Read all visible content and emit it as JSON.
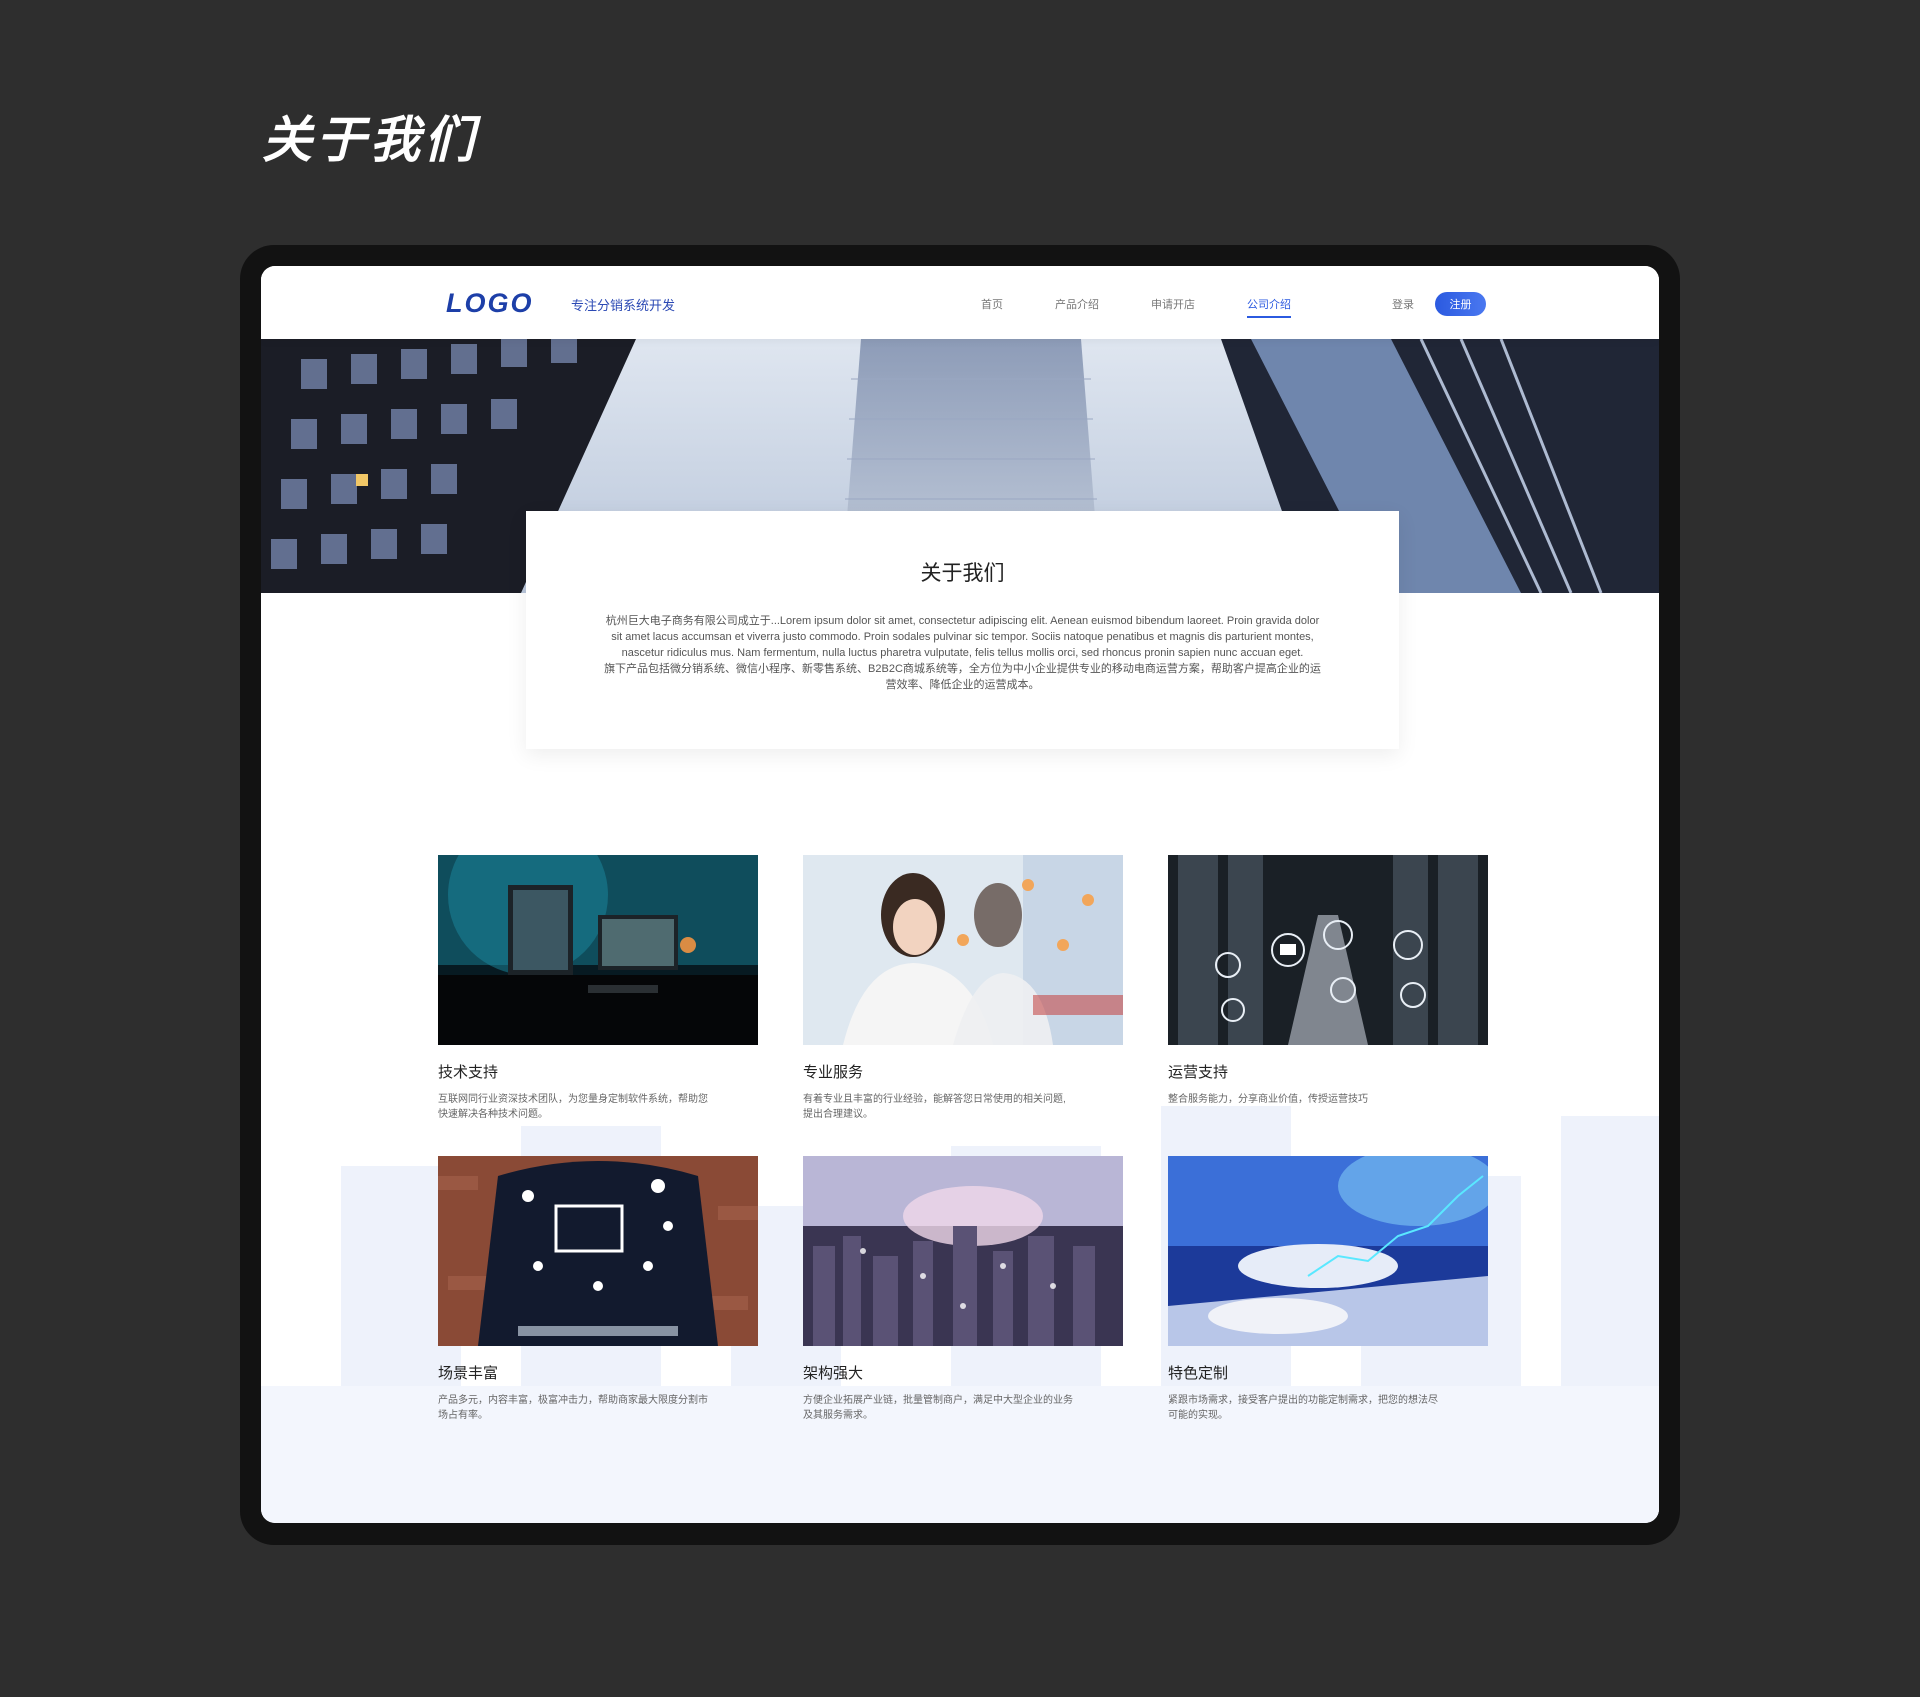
{
  "page_heading": "关于我们",
  "header": {
    "logo": "LOGO",
    "tagline": "专注分销系统开发",
    "nav": [
      {
        "label": "首页",
        "active": false
      },
      {
        "label": "产品介绍",
        "active": false
      },
      {
        "label": "申请开店",
        "active": false
      },
      {
        "label": "公司介绍",
        "active": true
      }
    ],
    "login": "登录",
    "register": "注册"
  },
  "about": {
    "title": "关于我们",
    "paragraph_1": "杭州巨大电子商务有限公司成立于...Lorem ipsum dolor sit amet, consectetur adipiscing elit. Aenean euismod bibendum laoreet. Proin gravida dolor sit amet lacus accumsan et viverra justo commodo. Proin sodales pulvinar sic tempor. Sociis natoque penatibus et magnis dis parturient montes, nascetur ridiculus mus. Nam fermentum, nulla luctus pharetra vulputate, felis tellus mollis orci, sed rhoncus pronin sapien nunc accuan eget.",
    "paragraph_2": "旗下产品包括微分销系统、微信小程序、新零售系统、B2B2C商城系统等，全方位为中小企业提供专业的移动电商运营方案，帮助客户提高企业的运营效率、降低企业的运营成本。"
  },
  "features": [
    {
      "title": "技术支持",
      "desc": "互联网同行业资深技术团队，为您量身定制软件系统，帮助您快速解决各种技术问题。",
      "image": "computer-workstation"
    },
    {
      "title": "专业服务",
      "desc": "有着专业且丰富的行业经验，能解答您日常使用的相关问题,提出合理建议。",
      "image": "customer-service"
    },
    {
      "title": "运营支持",
      "desc": "整合服务能力，分享商业价值，传授运营技巧",
      "image": "server-network"
    },
    {
      "title": "场景丰富",
      "desc": "产品多元，内容丰富，极富冲击力，帮助商家最大限度分割市场占有率。",
      "image": "live-streaming"
    },
    {
      "title": "架构强大",
      "desc": "方便企业拓展产业链，批量管制商户，满足中大型企业的业务及其服务需求。",
      "image": "city-network"
    },
    {
      "title": "特色定制",
      "desc": "紧跟市场需求，接受客户提出的功能定制需求，把您的想法尽可能的实现。",
      "image": "data-keyboard"
    }
  ],
  "colors": {
    "background": "#2e2e2e",
    "brand_blue": "#1d3fa8",
    "accent_blue": "#2b5ae0"
  }
}
